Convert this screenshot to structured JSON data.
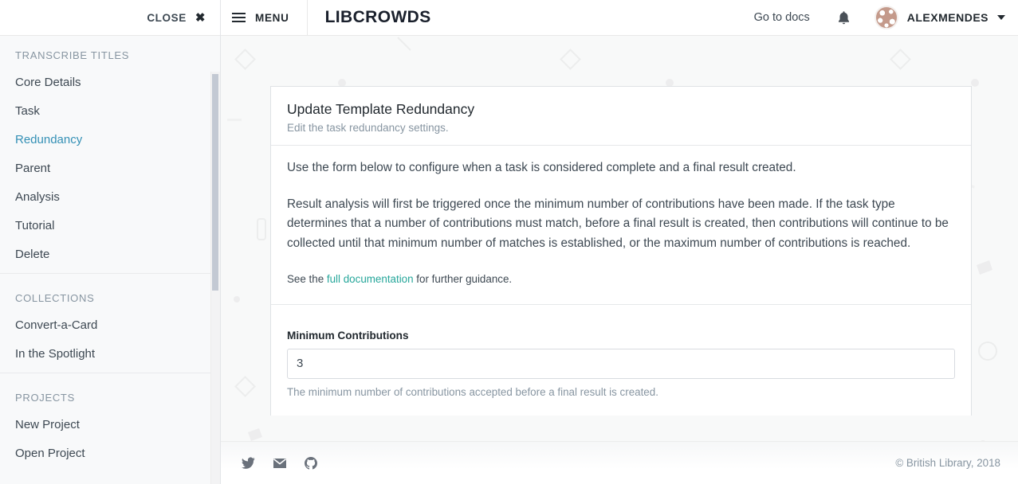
{
  "sidebar": {
    "close_label": "CLOSE",
    "close_icon": "close-x-icon",
    "groups": [
      {
        "heading": "TRANSCRIBE TITLES",
        "items": [
          {
            "label": "Core Details",
            "active": false
          },
          {
            "label": "Task",
            "active": false
          },
          {
            "label": "Redundancy",
            "active": true
          },
          {
            "label": "Parent",
            "active": false
          },
          {
            "label": "Analysis",
            "active": false
          },
          {
            "label": "Tutorial",
            "active": false
          },
          {
            "label": "Delete",
            "active": false
          }
        ]
      },
      {
        "heading": "COLLECTIONS",
        "items": [
          {
            "label": "Convert-a-Card",
            "active": false
          },
          {
            "label": "In the Spotlight",
            "active": false
          }
        ]
      },
      {
        "heading": "PROJECTS",
        "items": [
          {
            "label": "New Project",
            "active": false
          },
          {
            "label": "Open Project",
            "active": false
          }
        ]
      }
    ]
  },
  "topbar": {
    "menu_label": "MENU",
    "menu_icon": "hamburger-icon",
    "brand": "LIBCROWDS",
    "docs_label": "Go to docs",
    "bell_icon": "notification-bell-icon",
    "avatar_icon": "user-avatar",
    "user_name": "ALEXMENDES",
    "caret_icon": "chevron-down-icon"
  },
  "card": {
    "title": "Update Template Redundancy",
    "subtitle": "Edit the task redundancy settings.",
    "paragraph_1": "Use the form below to configure when a task is considered complete and a final result created.",
    "paragraph_2": "Result analysis will first be triggered once the minimum number of contributions have been made. If the task type determines that a number of contributions must match, before a final result is created, then contributions will continue to be collected until that minimum number of matches is established, or the maximum number of contributions is reached.",
    "note_prefix": "See the ",
    "note_link": "full documentation",
    "note_suffix": " for further guidance.",
    "link_color": "#25a69a"
  },
  "form": {
    "label": "Minimum Contributions",
    "value": "3",
    "placeholder": "",
    "help": "The minimum number of contributions accepted before a final result is created."
  },
  "footer": {
    "icons": [
      {
        "name": "twitter-icon"
      },
      {
        "name": "email-icon"
      },
      {
        "name": "github-icon"
      }
    ],
    "copyright": "© British Library, 2018"
  },
  "colors": {
    "accent_link": "#25a69a",
    "active_nav": "#3490b5",
    "text": "#3d4852",
    "muted": "#8795a1",
    "canvas_bg": "#f8f9f9",
    "avatar": "#c49a8b"
  }
}
